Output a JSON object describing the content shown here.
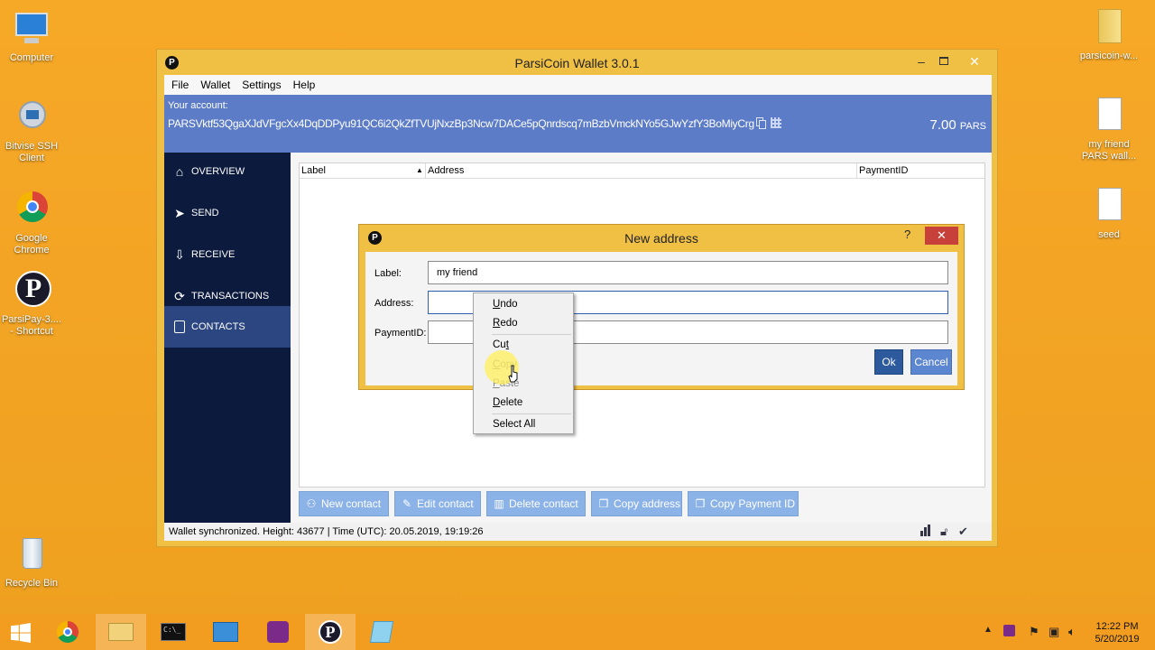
{
  "desktop": {
    "icons_left": [
      {
        "label": "Computer"
      },
      {
        "label": "Bitvise SSH Client"
      },
      {
        "label": "Google Chrome"
      },
      {
        "label": "ParsiPay-3.... - Shortcut"
      },
      {
        "label": "Recycle Bin"
      }
    ],
    "icons_right": [
      {
        "label": "parsicoin-w..."
      },
      {
        "label": "my friend PARS wall..."
      },
      {
        "label": "seed"
      }
    ]
  },
  "window": {
    "title": "ParsiCoin Wallet 3.0.1",
    "menu": [
      "File",
      "Wallet",
      "Settings",
      "Help"
    ],
    "account_label": "Your account:",
    "account_address": "PARSVktf53QgaXJdVFgcXx4DqDDPyu91QC6i2QkZfTVUjNxzBp3Ncw7DACe5pQnrdscq7mBzbVmckNYo5GJwYzfY3BoMiyCrgX",
    "balance_value": "7.00",
    "balance_unit": "PARS",
    "nav": [
      "OVERVIEW",
      "SEND",
      "RECEIVE",
      "TRANSACTIONS",
      "CONTACTS"
    ],
    "table_headers": [
      "Label",
      "Address",
      "PaymentID"
    ],
    "actions": [
      "New contact",
      "Edit contact",
      "Delete contact",
      "Copy address",
      "Copy Payment ID"
    ],
    "status": "Wallet synchronized. Height: 43677  |  Time (UTC): 20.05.2019, 19:19:26"
  },
  "dialog": {
    "title": "New address",
    "help": "?",
    "label_caption": "Label:",
    "label_value": "my friend",
    "address_caption": "Address:",
    "address_value": "",
    "paymentid_caption": "PaymentID:",
    "paymentid_value": "",
    "ok": "Ok",
    "cancel": "Cancel"
  },
  "context_menu": {
    "undo": {
      "first": "U",
      "rest": "ndo"
    },
    "redo": {
      "first": "R",
      "rest": "edo"
    },
    "cut": {
      "pre": "Cu",
      "ul": "t",
      "post": ""
    },
    "copy": {
      "first": "C",
      "rest": "opy"
    },
    "paste": {
      "first": "P",
      "rest": "aste"
    },
    "delete": {
      "first": "D",
      "rest": "elete"
    },
    "select_all": "Select All"
  },
  "taskbar": {
    "time": "12:22 PM",
    "date": "5/20/2019"
  },
  "colors": {
    "desktop": "#f4a525",
    "account_bar": "#5d7cc8",
    "sidebar": "#0c1a3d",
    "action_button": "#8cb3e8"
  }
}
